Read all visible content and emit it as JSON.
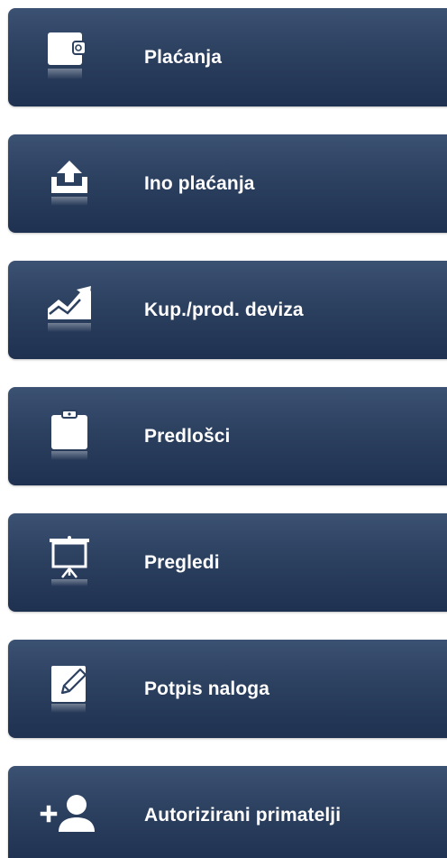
{
  "menu": {
    "items": [
      {
        "label": "Plaćanja",
        "icon": "wallet-icon"
      },
      {
        "label": "Ino plaćanja",
        "icon": "upload-tray-icon"
      },
      {
        "label": "Kup./prod. deviza",
        "icon": "trend-chart-icon"
      },
      {
        "label": "Predlošci",
        "icon": "clipboard-icon"
      },
      {
        "label": "Pregledi",
        "icon": "presentation-board-icon"
      },
      {
        "label": "Potpis naloga",
        "icon": "sign-document-icon"
      },
      {
        "label": "Autorizirani primatelji",
        "icon": "add-user-icon"
      }
    ]
  },
  "colors": {
    "tile_top": "#3c5273",
    "tile_bottom": "#1f3150",
    "text": "#ffffff"
  }
}
